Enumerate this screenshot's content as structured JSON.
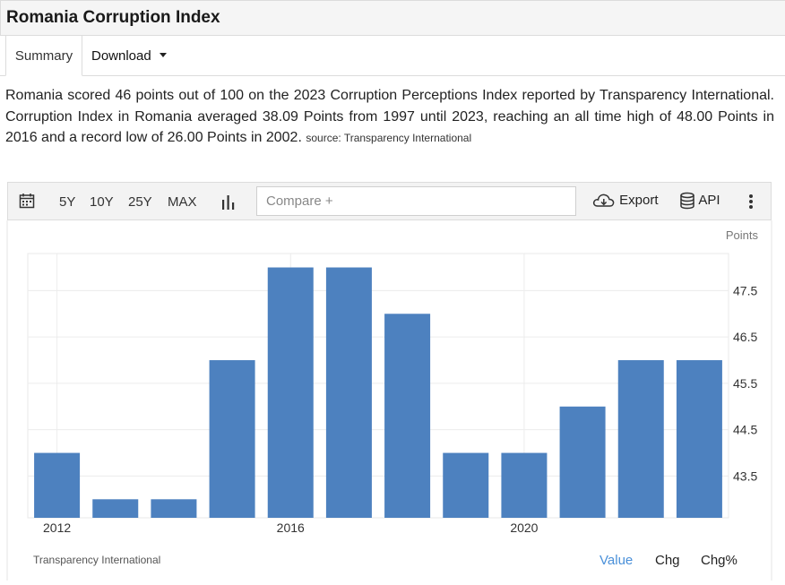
{
  "page": {
    "title": "Romania Corruption Index"
  },
  "tabs": {
    "summary": "Summary",
    "download": "Download"
  },
  "description": {
    "text": "Romania scored 46 points out of 100 on the 2023 Corruption Perceptions Index reported by Transparency International. Corruption Index in Romania averaged 38.09 Points from 1997 until 2023, reaching an all time high of 48.00 Points in 2016 and a record low of 26.00 Points in 2002.",
    "source": "source: Transparency International"
  },
  "toolbar": {
    "ranges": [
      "5Y",
      "10Y",
      "25Y",
      "MAX"
    ],
    "compare_placeholder": "Compare +",
    "export_label": "Export",
    "api_label": "API",
    "icons": [
      "calendar-icon",
      "bar-chart-icon",
      "cloud-download-icon",
      "database-icon",
      "more-vertical-icon"
    ]
  },
  "chart_data": {
    "type": "bar",
    "categories": [
      "2012",
      "2013",
      "2014",
      "2015",
      "2016",
      "2017",
      "2018",
      "2019",
      "2020",
      "2021",
      "2022",
      "2023"
    ],
    "values": [
      44,
      43,
      43,
      46,
      48,
      48,
      47,
      44,
      44,
      45,
      46,
      46
    ],
    "x_tick_labels": [
      "2012",
      "2016",
      "2020"
    ],
    "y_ticks": [
      43.5,
      44.5,
      45.5,
      46.5,
      47.5
    ],
    "ylim": [
      42.6,
      48.3
    ],
    "ylabel": "Points",
    "color": "#4d81bf",
    "grid": true
  },
  "footer": {
    "source": "Transparency International",
    "modes": [
      "Value",
      "Chg",
      "Chg%"
    ],
    "active_color": "#4a90d9"
  }
}
